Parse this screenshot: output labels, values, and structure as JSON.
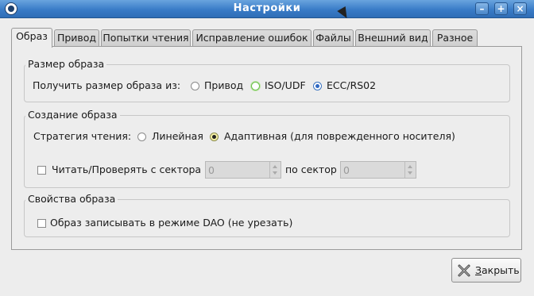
{
  "window": {
    "title": "Настройки"
  },
  "tabs": [
    {
      "label": "Образ"
    },
    {
      "label": "Привод"
    },
    {
      "label": "Попытки чтения"
    },
    {
      "label": "Исправление ошибок"
    },
    {
      "label": "Файлы"
    },
    {
      "label": "Внешний вид"
    },
    {
      "label": "Разное"
    }
  ],
  "image_size": {
    "legend": "Размер образа",
    "prompt": "Получить размер образа из:",
    "options": [
      {
        "label": "Привод",
        "selected": false
      },
      {
        "label": "ISO/UDF",
        "selected": false
      },
      {
        "label": "ECC/RS02",
        "selected": true
      }
    ]
  },
  "image_creation": {
    "legend": "Создание образа",
    "strategy_label": "Стратегия чтения:",
    "strategies": [
      {
        "label": "Линейная",
        "selected": false
      },
      {
        "label": "Адаптивная (для поврежденного носителя)",
        "selected": true
      }
    ],
    "range_checkbox_label": "Читать/Проверять с сектора",
    "from_value": "0",
    "to_label": "по сектор",
    "to_value": "0"
  },
  "image_props": {
    "legend": "Свойства образа",
    "dao_label": "Образ записывать в режиме DAO (не урезать)"
  },
  "footer": {
    "close_mnemonic": "З",
    "close_rest": "акрыть"
  }
}
